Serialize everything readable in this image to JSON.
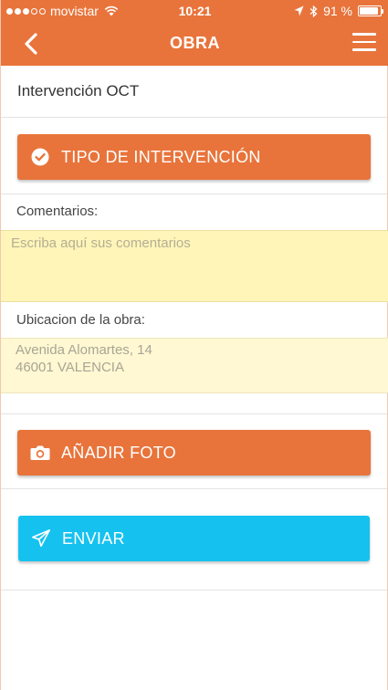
{
  "status_bar": {
    "carrier": "movistar",
    "time": "10:21",
    "battery": "91 %",
    "battery_level": 0.91
  },
  "nav": {
    "title": "OBRA"
  },
  "subtitle": "Intervención OCT",
  "tipo_button": {
    "label": "TIPO DE INTERVENCIÓN",
    "icon": "check-circle-icon"
  },
  "comments": {
    "label": "Comentarios:",
    "placeholder": "Escriba aquí sus comentarios",
    "value": ""
  },
  "location": {
    "label": "Ubicacion de la obra:",
    "line1": "Avenida Alomartes, 14",
    "line2": "46001 VALENCIA"
  },
  "photo_button": {
    "label": "AÑADIR FOTO",
    "icon": "camera-icon"
  },
  "send_button": {
    "label": "ENVIAR",
    "icon": "paper-plane-icon"
  },
  "colors": {
    "brand": "#e8743b",
    "send": "#15c2ef",
    "field_bg": "#fff5b9"
  }
}
